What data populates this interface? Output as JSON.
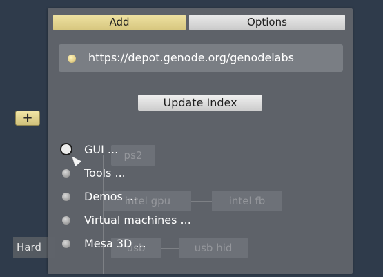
{
  "background": {
    "add_label": "+",
    "hardware_label": "Hard"
  },
  "tabs": {
    "add": "Add",
    "options": "Options"
  },
  "depot": {
    "url": "https://depot.genode.org/genodelabs"
  },
  "update_button": "Update Index",
  "ghost_nodes": {
    "ps2": "ps2",
    "gpu": "intel gpu",
    "fb": "intel fb",
    "hci": "usb",
    "hid": "usb hid"
  },
  "menu_items": [
    {
      "label": "GUI ..."
    },
    {
      "label": "Tools ..."
    },
    {
      "label": "Demos ..."
    },
    {
      "label": "Virtual machines ..."
    },
    {
      "label": "Mesa 3D ..."
    }
  ],
  "colors": {
    "desktop": "#2f3b4b",
    "panel": "#60646a",
    "tab_selected": "#e2d28f",
    "tab_normal": "#dcdcdc"
  }
}
